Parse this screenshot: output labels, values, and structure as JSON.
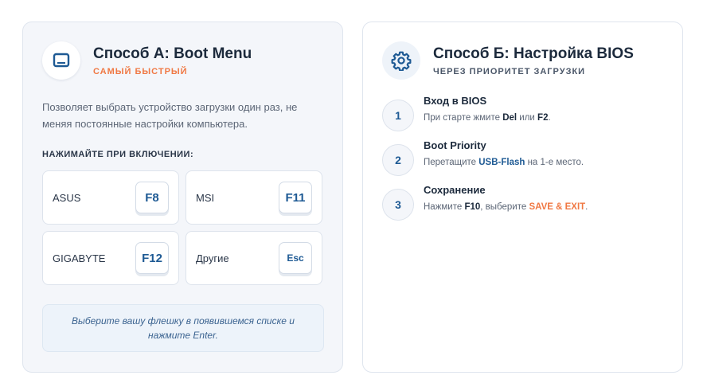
{
  "method_a": {
    "icon": "monitor-icon",
    "title": "Способ А: Boot Menu",
    "subtitle": "САМЫЙ БЫСТРЫЙ",
    "description": "Позволяет выбрать устройство загрузки один раз, не меняя постоянные настройки компьютера.",
    "press_label": "НАЖИМАЙТЕ ПРИ ВКЛЮЧЕНИИ:",
    "keys": [
      {
        "brand": "ASUS",
        "key": "F8"
      },
      {
        "brand": "MSI",
        "key": "F11"
      },
      {
        "brand": "GIGABYTE",
        "key": "F12"
      },
      {
        "brand": "Другие",
        "key": "Esc"
      }
    ],
    "hint": "Выберите вашу флешку в появившемся списке и нажмите Enter."
  },
  "method_b": {
    "icon": "gear-icon",
    "title": "Способ Б: Настройка BIOS",
    "subtitle": "ЧЕРЕЗ ПРИОРИТЕТ ЗАГРУЗКИ",
    "steps": [
      {
        "num": "1",
        "title": "Вход в BIOS",
        "text_pre": "При старте жмите ",
        "k1": "Del",
        "mid": " или ",
        "k2": "F2",
        "post": "."
      },
      {
        "num": "2",
        "title": "Boot Priority",
        "text_pre": "Перетащите ",
        "k1": "USB-Flash",
        "post": " на 1-е место."
      },
      {
        "num": "3",
        "title": "Сохранение",
        "text_pre": "Нажмите ",
        "k1": "F10",
        "mid": ", выберите ",
        "k2": "SAVE & EXIT",
        "post": "."
      }
    ]
  },
  "colors": {
    "accent_blue": "#1e5a94",
    "accent_orange": "#f07843",
    "card_bg": "#f4f6fa",
    "border": "#dfe5ee"
  }
}
